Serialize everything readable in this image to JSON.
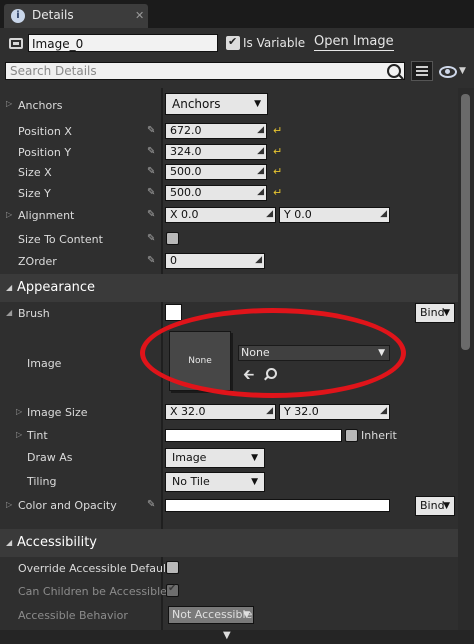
{
  "tab": {
    "title": "Details",
    "close": "✕"
  },
  "header": {
    "name_value": "Image_0",
    "is_variable_label": "Is Variable",
    "open_image_label": "Open Image",
    "search_placeholder": "Search Details"
  },
  "properties": {
    "anchors": {
      "label": "Anchors",
      "value": "Anchors"
    },
    "position_x": {
      "label": "Position X",
      "value": "672.0"
    },
    "position_y": {
      "label": "Position Y",
      "value": "324.0"
    },
    "size_x": {
      "label": "Size X",
      "value": "500.0"
    },
    "size_y": {
      "label": "Size Y",
      "value": "500.0"
    },
    "alignment": {
      "label": "Alignment",
      "x": "X  0.0",
      "y": "Y  0.0"
    },
    "size_to_content": {
      "label": "Size To Content"
    },
    "zorder": {
      "label": "ZOrder",
      "value": "0"
    }
  },
  "appearance": {
    "title": "Appearance",
    "brush_label": "Brush",
    "bind_label": "Bind",
    "image_label": "Image",
    "thumbnail_text": "None",
    "asset_value": "None",
    "image_size_label": "Image Size",
    "image_size_x": "X  32.0",
    "image_size_y": "Y  32.0",
    "tint_label": "Tint",
    "inherit_label": "Inherit",
    "draw_as_label": "Draw As",
    "draw_as_value": "Image",
    "tiling_label": "Tiling",
    "tiling_value": "No Tile",
    "color_opacity_label": "Color and Opacity"
  },
  "accessibility": {
    "title": "Accessibility",
    "override_label": "Override Accessible Defaults",
    "children_label": "Can Children be Accessible",
    "behavior_label": "Accessible Behavior",
    "behavior_value": "Not Accessible"
  },
  "colors": {
    "highlight_ring": "#e0141a",
    "reset_arrow": "#e7c430"
  }
}
